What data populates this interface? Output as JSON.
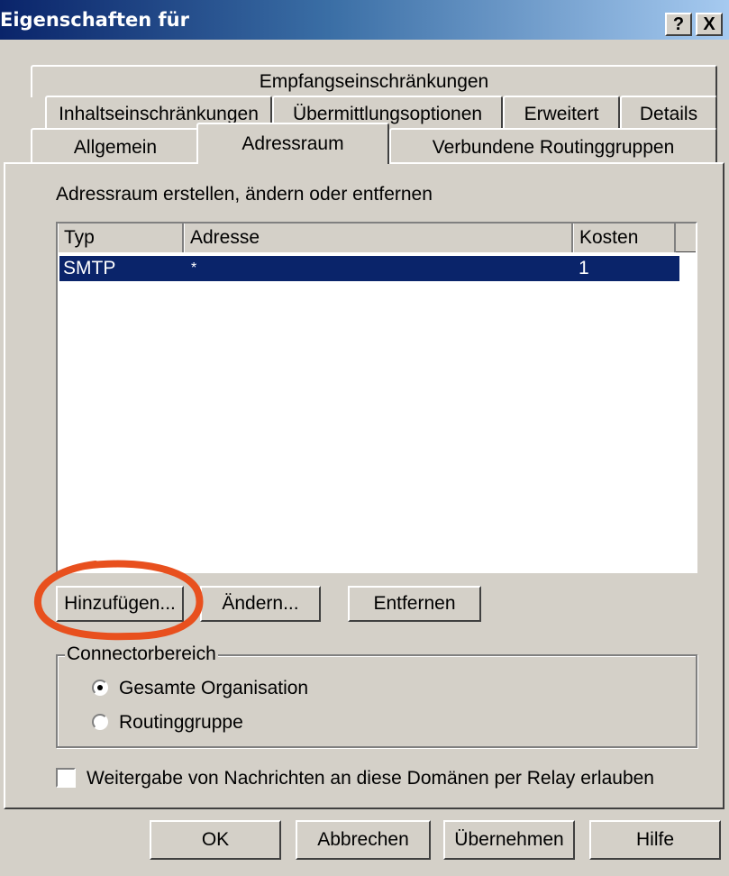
{
  "window": {
    "title": "Eigenschaften für",
    "help_button": "?",
    "close_button": "X"
  },
  "tabs": {
    "row1": [
      "Empfangseinschränkungen"
    ],
    "row2": [
      "Inhaltseinschränkungen",
      "Übermittlungsoptionen",
      "Erweitert",
      "Details"
    ],
    "row3": [
      "Allgemein",
      "Adressraum",
      "Verbundene Routinggruppen"
    ],
    "active": "Adressraum"
  },
  "panel": {
    "description": "Adressraum erstellen, ändern oder entfernen"
  },
  "address_list": {
    "columns": [
      "Typ",
      "Adresse",
      "Kosten"
    ],
    "rows": [
      {
        "typ": "SMTP",
        "adresse": "*",
        "kosten": "1",
        "selected": true
      }
    ]
  },
  "list_buttons": {
    "add": "Hinzufügen...",
    "edit": "Ändern...",
    "remove": "Entfernen"
  },
  "connector_scope": {
    "label": "Connectorbereich",
    "options": [
      {
        "label": "Gesamte Organisation",
        "selected": true
      },
      {
        "label": "Routinggruppe",
        "selected": false
      }
    ]
  },
  "relay_checkbox": {
    "label": "Weitergabe von Nachrichten an diese Domänen per Relay erlauben",
    "checked": false
  },
  "dialog_buttons": {
    "ok": "OK",
    "cancel": "Abbrechen",
    "apply": "Übernehmen",
    "help": "Hilfe"
  },
  "highlight": {
    "color": "#e8501e",
    "target": "Hinzufügen..."
  },
  "colors": {
    "face": "#d4d0c8",
    "selection": "#0a246a",
    "title_start": "#0a246a",
    "title_end": "#a6caf0"
  }
}
